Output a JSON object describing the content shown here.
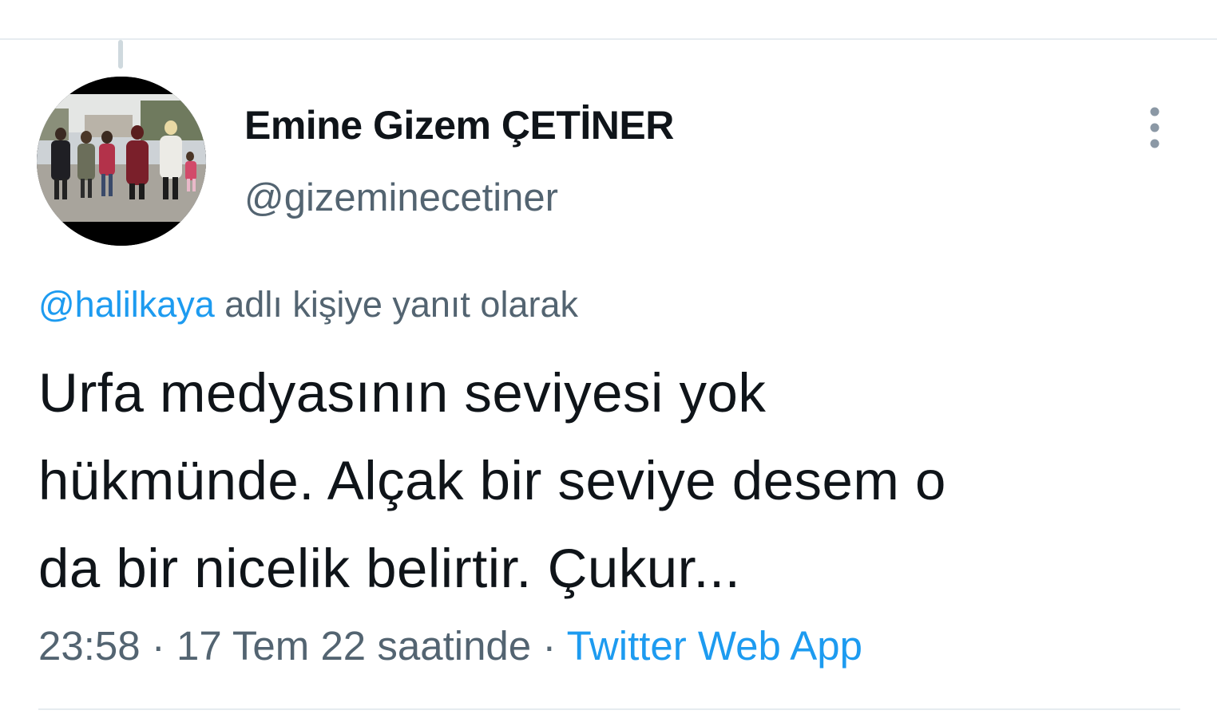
{
  "tweet": {
    "author": {
      "display_name": "Emine Gizem ÇETİNER",
      "handle": "@gizeminecetiner"
    },
    "reply_to": {
      "mention": "@halilkaya",
      "suffix": " adlı kişiye yanıt olarak"
    },
    "text_lines": [
      "Urfa medyasının seviyesi yok",
      "hükmünde. Alçak bir seviye desem o",
      "da bir nicelik belirtir. Çukur..."
    ],
    "meta": {
      "time": "23:58",
      "separator_1": " · ",
      "date": "17 Tem 22 saatinde",
      "separator_2": " · ",
      "source": "Twitter Web App"
    },
    "icons": {
      "more": "more-vertical-icon"
    },
    "colors": {
      "text_primary": "#0f1419",
      "text_secondary": "#536471",
      "link": "#1d9bf0",
      "more_icon": "#8b98a5"
    }
  }
}
